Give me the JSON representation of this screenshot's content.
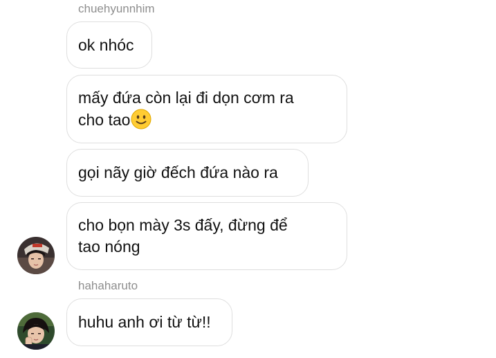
{
  "conversation": {
    "group1": {
      "sender": "chuehyunnhim",
      "messages": [
        {
          "text": "ok nhóc"
        },
        {
          "text": "mấy đứa còn lại đi dọn cơm ra\ncho tao",
          "emoji": "slightly-smiling-face"
        },
        {
          "text": "gọi nãy giờ đếch đứa nào ra"
        },
        {
          "text": "cho bọn mày 3s đấy, đừng để\ntao nóng"
        }
      ]
    },
    "group2": {
      "sender": "hahaharuto",
      "messages": [
        {
          "text": "huhu anh ơi từ từ!!"
        }
      ]
    }
  },
  "colors": {
    "bubble_border": "#dedede",
    "sender_text": "#8e8e8e",
    "message_text": "#111111",
    "background": "#ffffff"
  }
}
